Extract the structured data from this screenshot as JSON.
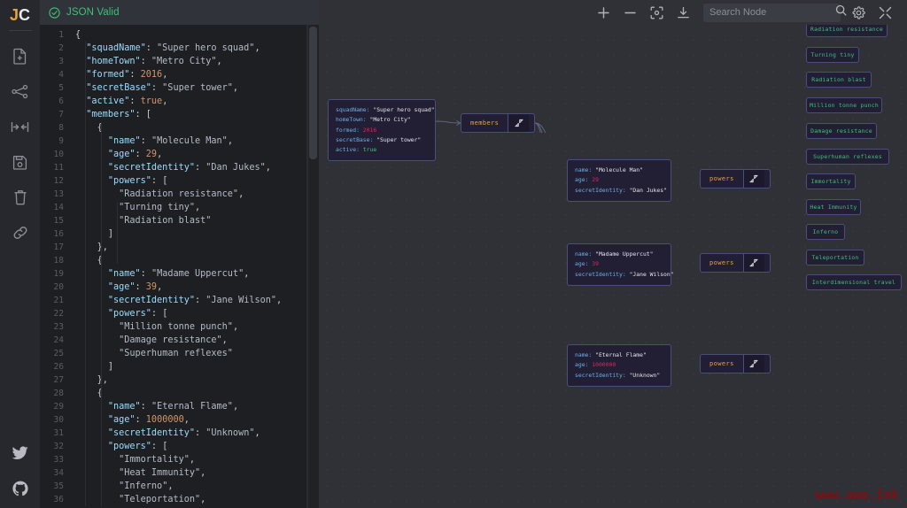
{
  "app": {
    "logo_j": "J",
    "logo_c": "C",
    "watermark": "www.aae.ink"
  },
  "sidebar": {
    "items": [
      {
        "name": "new-file-icon",
        "label": "New file"
      },
      {
        "name": "graph-icon",
        "label": "Graph view"
      },
      {
        "name": "collapse-icon",
        "label": "Collapse"
      },
      {
        "name": "save-icon",
        "label": "Save"
      },
      {
        "name": "trash-icon",
        "label": "Delete"
      },
      {
        "name": "link-icon",
        "label": "Share link"
      }
    ],
    "bottom_items": [
      {
        "name": "twitter-icon",
        "label": "Twitter"
      },
      {
        "name": "github-icon",
        "label": "GitHub"
      }
    ]
  },
  "editor": {
    "status_text": "JSON Valid",
    "status_icon": "check-circle-icon",
    "status_color": "#3fc07a",
    "line_numbers": [
      1,
      2,
      3,
      4,
      5,
      6,
      7,
      8,
      9,
      10,
      11,
      12,
      13,
      14,
      15,
      16,
      17,
      18,
      19,
      20,
      21,
      22,
      23,
      24,
      25,
      26,
      27,
      28,
      29,
      30,
      31,
      32,
      33,
      34,
      35,
      36
    ],
    "lines": [
      "{",
      "  \"squadName\": \"Super hero squad\",",
      "  \"homeTown\": \"Metro City\",",
      "  \"formed\": 2016,",
      "  \"secretBase\": \"Super tower\",",
      "  \"active\": true,",
      "  \"members\": [",
      "    {",
      "      \"name\": \"Molecule Man\",",
      "      \"age\": 29,",
      "      \"secretIdentity\": \"Dan Jukes\",",
      "      \"powers\": [",
      "        \"Radiation resistance\",",
      "        \"Turning tiny\",",
      "        \"Radiation blast\"",
      "      ]",
      "    },",
      "    {",
      "      \"name\": \"Madame Uppercut\",",
      "      \"age\": 39,",
      "      \"secretIdentity\": \"Jane Wilson\",",
      "      \"powers\": [",
      "        \"Million tonne punch\",",
      "        \"Damage resistance\",",
      "        \"Superhuman reflexes\"",
      "      ]",
      "    },",
      "    {",
      "      \"name\": \"Eternal Flame\",",
      "      \"age\": 1000000,",
      "      \"secretIdentity\": \"Unknown\",",
      "      \"powers\": [",
      "        \"Immortality\",",
      "        \"Heat Immunity\",",
      "        \"Inferno\",",
      "        \"Teleportation\","
    ]
  },
  "toolbar": {
    "buttons": [
      {
        "name": "zoom-in-icon",
        "label": "Zoom in"
      },
      {
        "name": "zoom-out-icon",
        "label": "Zoom out"
      },
      {
        "name": "center-view-icon",
        "label": "Center view"
      },
      {
        "name": "download-icon",
        "label": "Download"
      }
    ],
    "search": {
      "placeholder": "Search Node",
      "value": "",
      "icon": "search-icon"
    },
    "settings_icon": "gear-icon",
    "fullscreen_icon": "collapse-arrows-icon"
  },
  "graph": {
    "root_node": {
      "rows": [
        {
          "key": "squadName",
          "value": "\"Super hero squad\"",
          "type": "string"
        },
        {
          "key": "homeTown",
          "value": "\"Metro City\"",
          "type": "string"
        },
        {
          "key": "formed",
          "value": "2016",
          "type": "number"
        },
        {
          "key": "secretBase",
          "value": "\"Super tower\"",
          "type": "string"
        },
        {
          "key": "active",
          "value": "true",
          "type": "boolean"
        }
      ]
    },
    "members_node": {
      "label": "members"
    },
    "member_nodes": [
      {
        "rows": [
          {
            "key": "name",
            "value": "\"Molecule Man\"",
            "type": "string"
          },
          {
            "key": "age",
            "value": "29",
            "type": "number"
          },
          {
            "key": "secretIdentity",
            "value": "\"Dan Jukes\"",
            "type": "string"
          }
        ],
        "powers_label": "powers",
        "powers": [
          "Radiation resistance",
          "Turning tiny",
          "Radiation blast"
        ]
      },
      {
        "rows": [
          {
            "key": "name",
            "value": "\"Madame Uppercut\"",
            "type": "string"
          },
          {
            "key": "age",
            "value": "39",
            "type": "number"
          },
          {
            "key": "secretIdentity",
            "value": "\"Jane Wilson\"",
            "type": "string"
          }
        ],
        "powers_label": "powers",
        "powers": [
          "Million tonne punch",
          "Damage resistance",
          "Superhuman reflexes"
        ]
      },
      {
        "rows": [
          {
            "key": "name",
            "value": "\"Eternal Flame\"",
            "type": "string"
          },
          {
            "key": "age",
            "value": "1000000",
            "type": "number"
          },
          {
            "key": "secretIdentity",
            "value": "\"Unknown\"",
            "type": "string"
          }
        ],
        "powers_label": "powers",
        "powers": [
          "Immortality",
          "Heat Immunity",
          "Inferno",
          "Teleportation",
          "Interdimensional travel"
        ]
      }
    ]
  },
  "colors": {
    "accent_orange": "#e8a33d",
    "valid_green": "#3fc07a",
    "node_border": "#4a4f78",
    "node_bg": "#221f35",
    "canvas_bg": "#2f3136",
    "editor_bg": "#1e1f22",
    "watermark": "#7e0f13"
  }
}
